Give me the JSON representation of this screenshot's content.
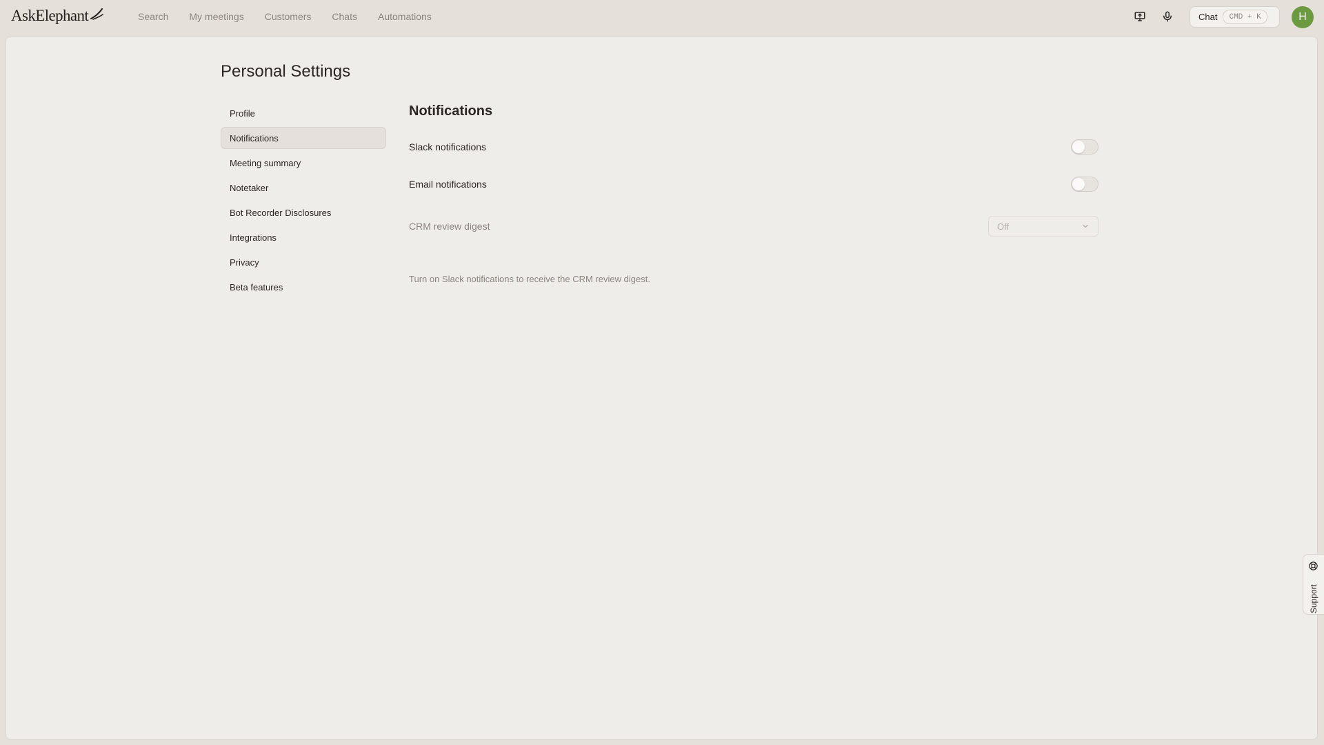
{
  "brand": {
    "name": "AskElephant"
  },
  "nav": {
    "items": [
      {
        "label": "Search"
      },
      {
        "label": "My meetings"
      },
      {
        "label": "Customers"
      },
      {
        "label": "Chats"
      },
      {
        "label": "Automations"
      }
    ]
  },
  "topbar": {
    "present_icon": "present-screen-icon",
    "mic_icon": "microphone-icon",
    "chat_label": "Chat",
    "chat_shortcut": "CMD + K",
    "avatar_initial": "H",
    "avatar_color": "#6b9a41"
  },
  "page": {
    "title": "Personal Settings"
  },
  "settings_nav": {
    "items": [
      {
        "label": "Profile",
        "active": false
      },
      {
        "label": "Notifications",
        "active": true
      },
      {
        "label": "Meeting summary",
        "active": false
      },
      {
        "label": "Notetaker",
        "active": false
      },
      {
        "label": "Bot Recorder Disclosures",
        "active": false
      },
      {
        "label": "Integrations",
        "active": false
      },
      {
        "label": "Privacy",
        "active": false
      },
      {
        "label": "Beta features",
        "active": false
      }
    ]
  },
  "notifications": {
    "title": "Notifications",
    "slack": {
      "label": "Slack notifications",
      "enabled": false
    },
    "email": {
      "label": "Email notifications",
      "enabled": false
    },
    "crm_digest": {
      "label": "CRM review digest",
      "value": "Off",
      "disabled": true,
      "helper": "Turn on Slack notifications to receive the CRM review digest."
    }
  },
  "support": {
    "label": "Support",
    "icon": "lifebuoy-icon"
  }
}
